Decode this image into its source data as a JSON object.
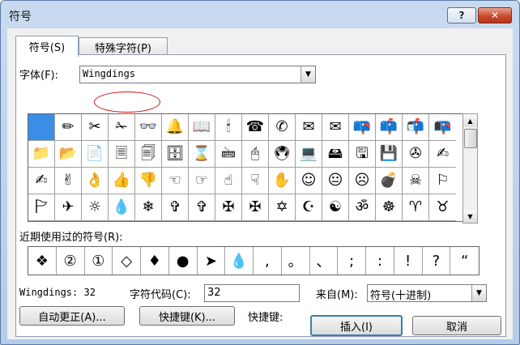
{
  "window": {
    "title": "符号",
    "help_label": "?",
    "close_label": "✕"
  },
  "tabs": [
    {
      "label": "符号(S)"
    },
    {
      "label": "特殊字符(P)"
    }
  ],
  "font": {
    "label": "字体(F):",
    "value": "Wingdings"
  },
  "symbols": [
    "",
    "✏",
    "✂",
    "✁",
    "👓",
    "🔔",
    "📖",
    "🕯",
    "☎",
    "✆",
    "✉",
    "✉",
    "📪",
    "📫",
    "📬",
    "📭",
    "📁",
    "📂",
    "📄",
    "🗏",
    "🗐",
    "🗄",
    "⌛",
    "🖮",
    "🖰",
    "🖲",
    "💻",
    "🖴",
    "🖫",
    "💾",
    "✇",
    "✍",
    "✍",
    "✌",
    "👌",
    "👍",
    "👎",
    "☜",
    "☞",
    "☝",
    "☟",
    "✋",
    "☺",
    "😐",
    "☹",
    "💣",
    "☠",
    "⚐",
    "🏱",
    "✈",
    "☼",
    "💧",
    "❄",
    "✞",
    "✞",
    "✠",
    "✠",
    "✡",
    "☪",
    "☯",
    "ॐ",
    "☸",
    "♈",
    "♉",
    "♊",
    "♋",
    "♌",
    "♍",
    "♎",
    "♏",
    "♐",
    "♑"
  ],
  "recent": {
    "label": "近期使用过的符号(R):",
    "items": [
      "❖",
      "②",
      "①",
      "◇",
      "♦",
      "●",
      "➤",
      "💧",
      ",",
      "。",
      "、",
      ";",
      ":",
      "!",
      "?",
      "“",
      "”",
      "("
    ]
  },
  "info": {
    "char_name": "Wingdings: 32",
    "code_label": "字符代码(C):",
    "code_value": "32",
    "from_label": "来自(M):",
    "from_value": "符号(十进制)"
  },
  "buttons": {
    "autocorrect": "自动更正(A)...",
    "shortcut_key": "快捷键(K)...",
    "shortcut_text": "快捷键:",
    "insert": "插入(I)",
    "cancel": "取消"
  }
}
